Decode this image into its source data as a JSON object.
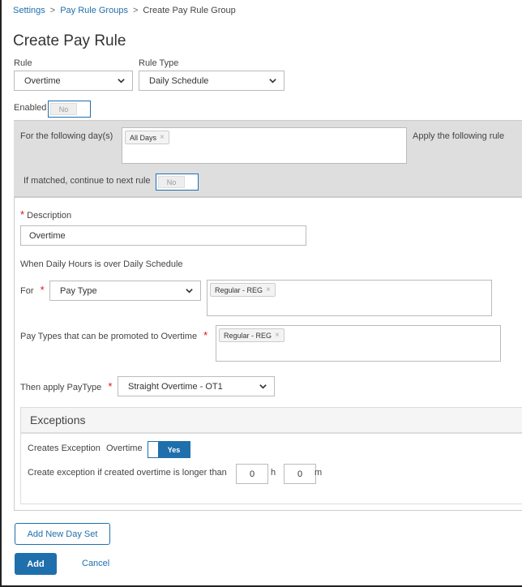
{
  "breadcrumb": {
    "items": [
      "Settings",
      "Pay Rule Groups"
    ],
    "current": "Create Pay Rule Group",
    "separator": ">"
  },
  "page_title": "Create Pay Rule",
  "rule": {
    "label": "Rule",
    "value": "Overtime"
  },
  "rule_type": {
    "label": "Rule Type",
    "value": "Daily Schedule"
  },
  "enabled": {
    "label": "Enabled",
    "value": "No"
  },
  "day_set": {
    "days_label": "For the following day(s)",
    "days_tags": [
      "All Days"
    ],
    "apply_label": "Apply the following rule",
    "continue_label": "If matched, continue to next rule",
    "continue_value": "No"
  },
  "form": {
    "description_label": "Description",
    "description_value": "Overtime",
    "condition_text": "When Daily Hours is over Daily Schedule",
    "for_label": "For",
    "for_value": "Pay Type",
    "for_tags": [
      "Regular - REG"
    ],
    "promotable_label": "Pay Types that can be promoted to Overtime",
    "promotable_tags": [
      "Regular - REG"
    ],
    "then_label": "Then apply PayType",
    "then_value": "Straight Overtime - OT1",
    "required_mark": "*",
    "tag_remove": "×"
  },
  "exceptions": {
    "title": "Exceptions",
    "creates_label": "Creates Exception",
    "creates_type": "Overtime",
    "creates_value": "Yes",
    "threshold_label": "Create exception if created overtime is longer than",
    "hours_value": "0",
    "hours_unit": "h",
    "minutes_value": "0",
    "minutes_unit": "m"
  },
  "buttons": {
    "add_day_set": "Add New Day Set",
    "add": "Add",
    "cancel": "Cancel"
  },
  "colors": {
    "accent": "#1f6fad",
    "required": "#dd1111",
    "panel_gray": "#dedede"
  }
}
